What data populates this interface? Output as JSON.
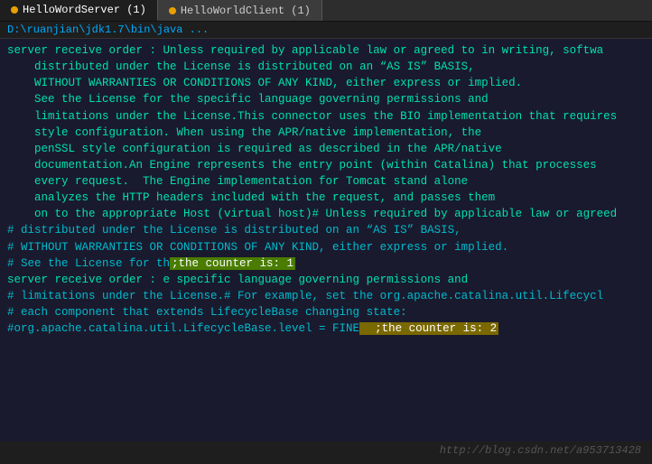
{
  "titlebar": {
    "tabs": [
      {
        "label": "HelloWordServer (1)",
        "active": true
      },
      {
        "label": "HelloWorldClient (1)",
        "active": false
      }
    ]
  },
  "pathbar": {
    "text": "D:\\ruanjian\\jdk1.7\\bin\\java ..."
  },
  "console": {
    "lines": [
      {
        "text": "server receive order : Unless required by applicable law or agreed to in writing, softwa",
        "type": "normal"
      },
      {
        "text": "    distributed under the License is distributed on an “AS IS” BASIS,",
        "type": "normal"
      },
      {
        "text": "    WITHOUT WARRANTIES OR CONDITIONS OF ANY KIND, either express or implied.",
        "type": "normal"
      },
      {
        "text": "    See the License for the specific language governing permissions and",
        "type": "normal"
      },
      {
        "text": "    limitations under the License.This connector uses the BIO implementation that requires",
        "type": "normal"
      },
      {
        "text": "    style configuration. When using the APR/native implementation, the",
        "type": "normal"
      },
      {
        "text": "    penSSL style configuration is required as described in the APR/native",
        "type": "normal"
      },
      {
        "text": "    documentation.An Engine represents the entry point (within Catalina) that processes",
        "type": "normal"
      },
      {
        "text": "    every request.  The Engine implementation for Tomcat stand alone",
        "type": "normal"
      },
      {
        "text": "    analyzes the HTTP headers included with the request, and passes them",
        "type": "normal"
      },
      {
        "text": "    on to the appropriate Host (virtual host)# Unless required by applicable law or agreed",
        "type": "normal"
      },
      {
        "text": "# distributed under the License is distributed on an “AS IS” BASIS,",
        "type": "comment"
      },
      {
        "text": "# WITHOUT WARRANTIES OR CONDITIONS OF ANY KIND, either express or implied.",
        "type": "comment"
      },
      {
        "text": "# See the License for th",
        "type": "comment",
        "highlight": {
          "text": ";the counter is: 1",
          "style": "green",
          "after": ""
        }
      },
      {
        "text": "server receive order : e specific language governing permissions and",
        "type": "normal"
      },
      {
        "text": "# limitations under the License.# For example, set the org.apache.catalina.util.Lifecycl",
        "type": "comment"
      },
      {
        "text": "# each component that extends LifecycleBase changing state:",
        "type": "comment"
      },
      {
        "text": "#org.apache.catalina.util.LifecycleBase.level = FINE",
        "type": "comment",
        "highlight": {
          "text": "  ;the counter is: 2",
          "style": "yellow",
          "after": ""
        }
      }
    ]
  },
  "watermark": {
    "text": "http://blog.csdn.net/a953713428"
  }
}
